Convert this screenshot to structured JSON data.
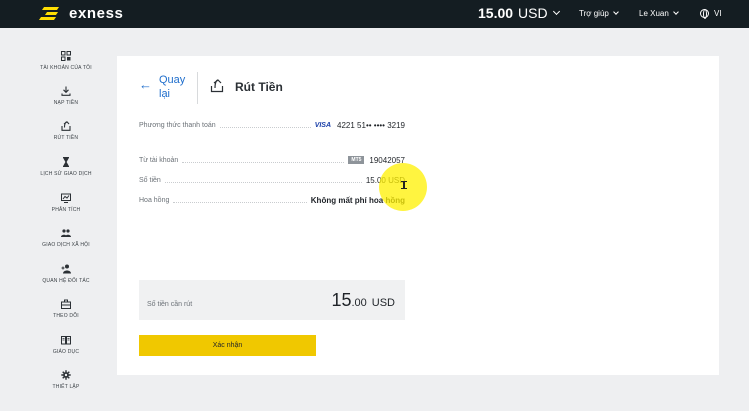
{
  "header": {
    "brand": "exness",
    "balance_amount": "15.00",
    "balance_currency": "USD",
    "help_label": "Trợ giúp",
    "user_name": "Le Xuan",
    "language": "VI"
  },
  "sidebar": {
    "items": [
      {
        "label": "Tài khoản của tôi",
        "icon": "grid-icon"
      },
      {
        "label": "Nạp tiền",
        "icon": "download-icon"
      },
      {
        "label": "Rút tiền",
        "icon": "upload-icon"
      },
      {
        "label": "Lịch sử giao dịch",
        "icon": "hourglass-icon"
      },
      {
        "label": "Phân tích",
        "icon": "chart-icon"
      },
      {
        "label": "Giao dịch xã hội",
        "icon": "people-icon"
      },
      {
        "label": "Quan hệ đối tác",
        "icon": "partner-icon"
      },
      {
        "label": "Theo dõi",
        "icon": "briefcase-icon"
      },
      {
        "label": "Giáo dục",
        "icon": "book-icon"
      },
      {
        "label": "Thiết lập",
        "icon": "gear-icon"
      }
    ]
  },
  "page": {
    "back_line1": "Quay",
    "back_line2": "lại",
    "title": "Rút Tiền"
  },
  "details": {
    "payment_method_label": "Phương thức thanh toán",
    "card_brand": "VISA",
    "card_number": "4221 51•• •••• 3219",
    "from_account_label": "Từ tài khoản",
    "account_type": "MT5",
    "account_number": "19042057",
    "amount_label": "Số tiền",
    "amount_value": "15.00 USD",
    "fee_label": "Hoa hồng",
    "fee_value": "Không mất phí hoa hồng"
  },
  "withdraw": {
    "label": "Số tiền cần rút",
    "amount_int": "15",
    "amount_dec": ".00",
    "currency": "USD",
    "confirm_label": "Xác nhận"
  },
  "colors": {
    "topbar": "#141d22",
    "accent_yellow": "#f0c800",
    "link_blue": "#1f6ecc"
  }
}
